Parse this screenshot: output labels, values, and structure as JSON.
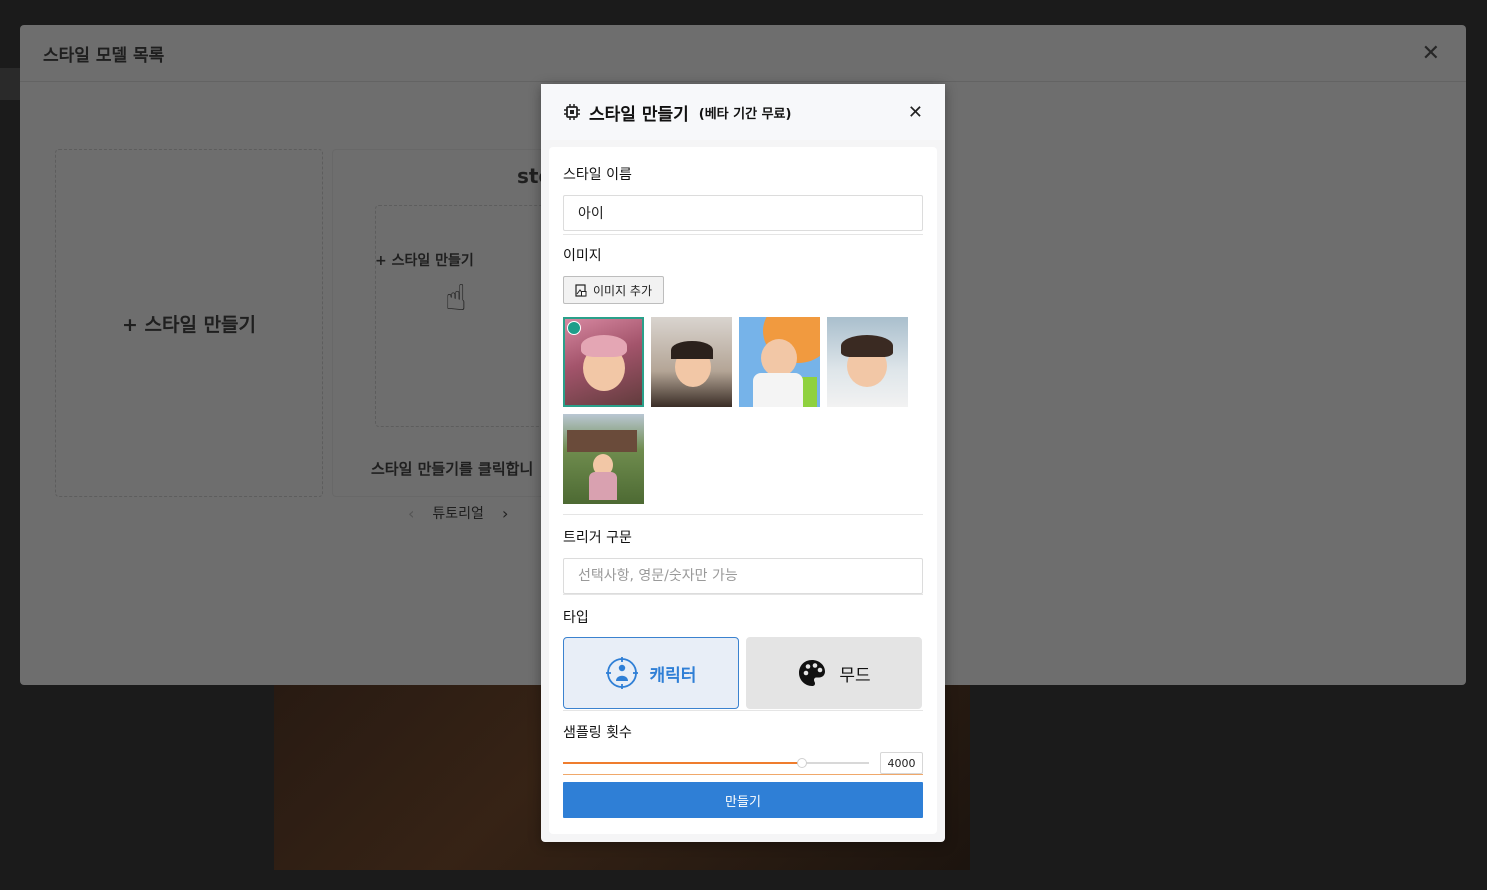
{
  "outer_modal": {
    "title": "스타일 모델 목록",
    "create_card_label": "+ 스타일 만들기",
    "tutorial": {
      "title_fragment": "sto",
      "inner_label": "+ 스타일 만들기",
      "caption": "스타일 만들기를 클릭합니",
      "nav_label": "튜토리얼"
    }
  },
  "modal": {
    "title": "스타일 만들기",
    "subtitle": "(베타 기간 무료)",
    "name_section": {
      "label": "스타일 이름",
      "value": "아이"
    },
    "image_section": {
      "label": "이미지",
      "add_button": "이미지 추가",
      "images": [
        {
          "name": "child-photo-1",
          "selected": true,
          "bg": "#c9778f"
        },
        {
          "name": "child-photo-2",
          "selected": false,
          "bg": "#b7a495"
        },
        {
          "name": "child-photo-3",
          "selected": false,
          "bg": "#6fb0e8"
        },
        {
          "name": "child-photo-4",
          "selected": false,
          "bg": "#9db6c6"
        },
        {
          "name": "child-photo-5",
          "selected": false,
          "bg": "#5f7a3e"
        }
      ]
    },
    "trigger_section": {
      "label": "트리거 구문",
      "placeholder": "선택사항, 영문/숫자만 가능"
    },
    "type_section": {
      "label": "타입",
      "options": [
        {
          "label": "캐릭터",
          "icon": "character-icon",
          "active": true
        },
        {
          "label": "무드",
          "icon": "palette-icon",
          "active": false
        }
      ]
    },
    "sampling_section": {
      "label": "샘플링 횟수",
      "value": "4000",
      "slider_fraction": 0.78
    },
    "submit_label": "만들기"
  }
}
